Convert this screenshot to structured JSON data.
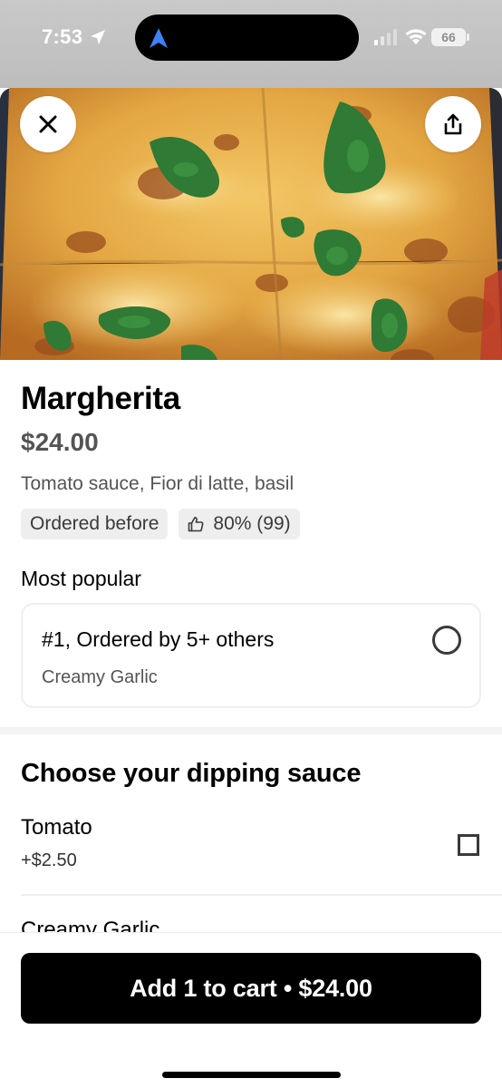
{
  "status_bar": {
    "time": "7:53",
    "battery": "66",
    "icons": [
      "location-arrow-icon",
      "navigation-icon",
      "signal-icon",
      "wifi-icon",
      "battery-icon"
    ]
  },
  "header": {
    "close_icon": "close-icon",
    "share_icon": "share-icon"
  },
  "item": {
    "title": "Margherita",
    "price": "$24.00",
    "description": "Tomato sauce, Fior di latte, basil",
    "chips": {
      "ordered_before": "Ordered before",
      "rating": "80% (99)"
    }
  },
  "most_popular": {
    "label": "Most popular",
    "option_name": "#1, Ordered by 5+ others",
    "option_detail": "Creamy Garlic",
    "selected": false
  },
  "dipping_sauce": {
    "title": "Choose your dipping sauce",
    "options": [
      {
        "name": "Tomato",
        "price": "+$2.50",
        "checked": false
      },
      {
        "name": "Creamy Garlic"
      }
    ]
  },
  "cart": {
    "button_label": "Add 1 to cart • $24.00"
  },
  "colors": {
    "primary": "#000000",
    "secondary_text": "#545454",
    "chip_bg": "#eeeeee",
    "nav_blue": "#3b82f6"
  }
}
